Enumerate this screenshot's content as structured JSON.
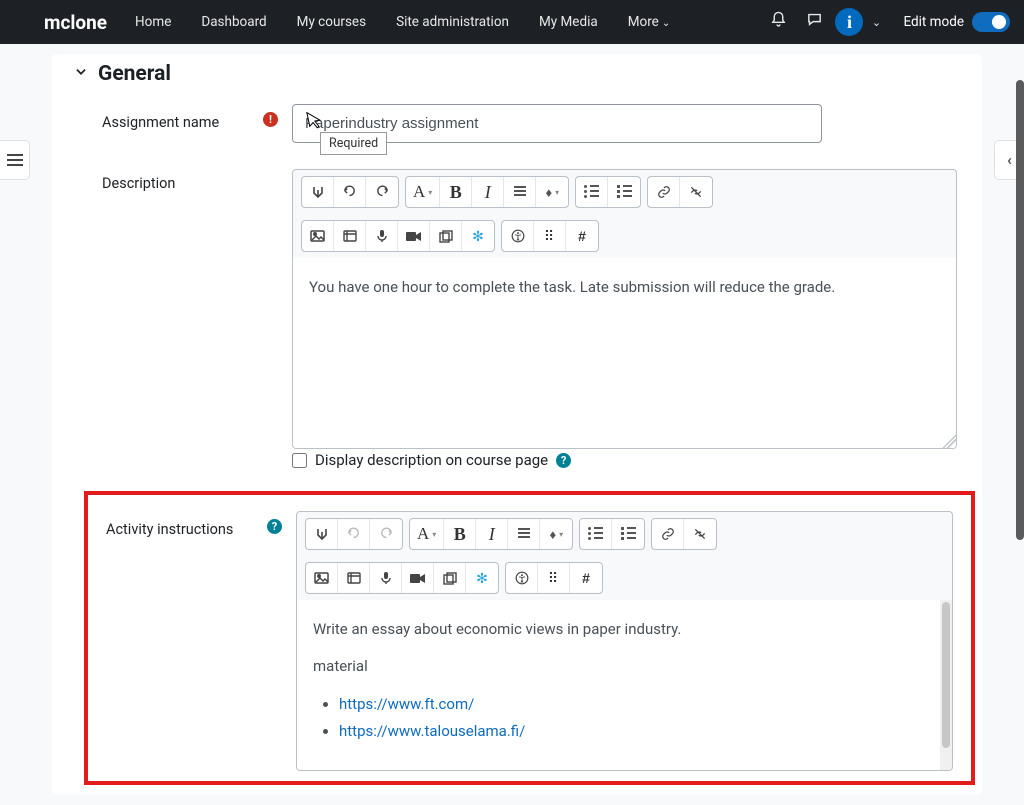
{
  "nav": {
    "brand": "mclone",
    "links": [
      "Home",
      "Dashboard",
      "My courses",
      "Site administration",
      "My Media"
    ],
    "more": "More",
    "editmode": "Edit mode"
  },
  "section": {
    "title": "General"
  },
  "assignment": {
    "label": "Assignment name",
    "value": "Paperindustry assignment",
    "required_tooltip": "Required"
  },
  "description": {
    "label": "Description",
    "text": "You have one hour to complete the task. Late submission will reduce the grade.",
    "display_checkbox": "Display description on course page"
  },
  "activity": {
    "label": "Activity instructions",
    "para1": "Write an essay about economic views in paper industry.",
    "para2": "material",
    "link1": "https://www.ft.com/",
    "link2": "https://www.talouselama.fi/"
  },
  "icons": {
    "bell": "🔔",
    "speech": "💬",
    "user": "i",
    "caret": "⌄",
    "listdrawer": "≡",
    "chevleft": "‹",
    "chevdown": "⌄",
    "req": "!",
    "help": "?",
    "cursor": "↖"
  },
  "editor_icons": {
    "expand": "↧",
    "undo": "↺",
    "redo": "↻",
    "A": "A",
    "dd": "▾",
    "B": "B",
    "I": "I",
    "para": "▤",
    "drop": "💧",
    "ul": "•",
    "ol": "1.",
    "link": "🔗",
    "unlink": "✂",
    "image": "img",
    "media": "▦",
    "mic": "🎤",
    "video": "■",
    "copy": "❐",
    "hsp": "✻",
    "a11y": "◉",
    "grid": "⠿",
    "hash": "#"
  }
}
